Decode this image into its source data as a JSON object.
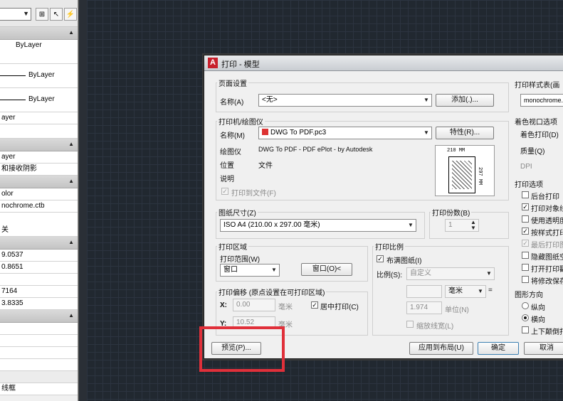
{
  "palette": {
    "rows": [
      "ByLayer",
      "ByLayer",
      "ByLayer",
      "ayer",
      "ayer",
      "和接收阴影",
      "olor",
      "nochrome.ctb",
      "关",
      "9.0537",
      "0.8651",
      "7164",
      "3.8335",
      "线框"
    ]
  },
  "dialog": {
    "title": "打印 - 模型",
    "page_setup": {
      "group_label": "页面设置",
      "name_label": "名称(A)",
      "name_value": "<无>",
      "add_button": "添加(.)..."
    },
    "plotter": {
      "group_label": "打印机/绘图仪",
      "name_label": "名称(M)",
      "name_value": "DWG To PDF.pc3",
      "properties_button": "特性(R)...",
      "plotter_label": "绘图仪",
      "plotter_value": "DWG To PDF - PDF ePlot - by Autodesk",
      "location_label": "位置",
      "location_value": "文件",
      "description_label": "说明",
      "plot_to_file_label": "打印到文件(F)",
      "plot_to_file_checked": true,
      "preview_width_text": "210 MM",
      "preview_height_text": "297 MM"
    },
    "paper_size": {
      "group_label": "图纸尺寸(Z)",
      "value": "ISO A4 (210.00 x 297.00 毫米)"
    },
    "copies": {
      "group_label": "打印份数(B)",
      "value": "1"
    },
    "plot_area": {
      "group_label": "打印区域",
      "range_label": "打印范围(W)",
      "range_value": "窗口",
      "window_button": "窗口(O)<"
    },
    "plot_offset": {
      "group_label": "打印偏移 (原点设置在可打印区域)",
      "x_label": "X:",
      "x_value": "0.00",
      "x_unit": "毫米",
      "y_label": "Y:",
      "y_value": "10.52",
      "y_unit": "毫米",
      "center_label": "居中打印(C)",
      "center_checked": true
    },
    "plot_scale": {
      "group_label": "打印比例",
      "fit_label": "布满图纸(I)",
      "fit_checked": true,
      "scale_label": "比例(S):",
      "scale_value": "自定义",
      "unit_value": "毫米",
      "equals": "=",
      "unit_ratio": "1.974",
      "unit_ratio_label": "单位(N)",
      "lineweights_label": "缩放线宽(L)",
      "lineweights_checked": false
    },
    "right_panel": {
      "style_table_label": "打印样式表(画",
      "style_table_value": "monochrome.ctb",
      "shaded_label": "着色视口选项",
      "shade_plot_label": "着色打印(D)",
      "quality_label": "质量(Q)",
      "dpi_label": "DPI",
      "options_label": "打印选项",
      "options": [
        {
          "label": "后台打印",
          "checked": false,
          "disabled": false
        },
        {
          "label": "打印对象线",
          "checked": true,
          "disabled": false
        },
        {
          "label": "使用透明度",
          "checked": false,
          "disabled": false
        },
        {
          "label": "按样式打印",
          "checked": true,
          "disabled": false
        },
        {
          "label": "最后打印图",
          "checked": true,
          "disabled": true
        },
        {
          "label": "隐藏图纸空",
          "checked": false,
          "disabled": false
        },
        {
          "label": "打开打印戳",
          "checked": false,
          "disabled": false
        },
        {
          "label": "将修改保存",
          "checked": false,
          "disabled": false
        }
      ],
      "orientation_label": "图形方向",
      "portrait_label": "纵向",
      "landscape_label": "横向",
      "upside_down_label": "上下颠倒打印"
    },
    "footer": {
      "preview_button": "预览(P)...",
      "apply_button": "应用到布局(U)",
      "ok_button": "确定",
      "cancel_button": "取消"
    }
  },
  "colors": {
    "highlight": "#e0303a",
    "canvas": "#212830",
    "autocad_red": "#c8202c"
  }
}
